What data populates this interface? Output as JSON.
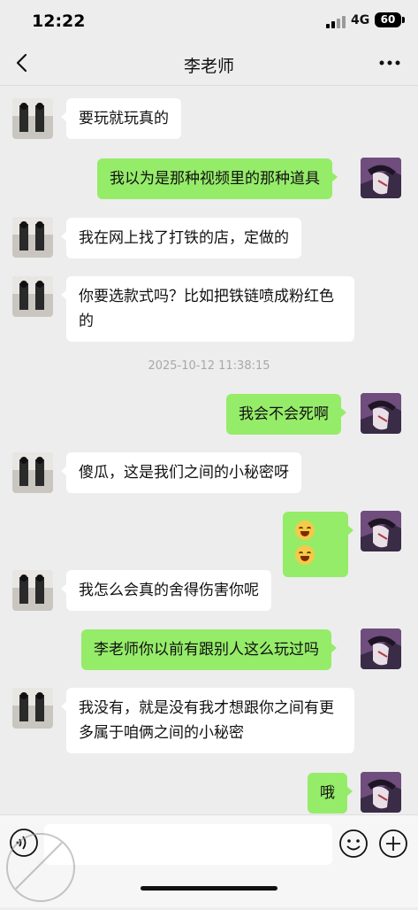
{
  "status_bar": {
    "time": "12:22",
    "network": "4G",
    "battery": "60"
  },
  "header": {
    "title": "李老师"
  },
  "timestamp": "2025-10-12 11:38:15",
  "messages": [
    {
      "side": "left",
      "text": "要玩就玩真的"
    },
    {
      "side": "right",
      "text": "我以为是那种视频里的那种道具"
    },
    {
      "side": "left",
      "text": "我在网上找了打铁的店，定做的"
    },
    {
      "side": "left",
      "text": "你要选款式吗？比如把铁链喷成粉红色的"
    },
    {
      "side": "right",
      "text": "我会不会死啊"
    },
    {
      "side": "left",
      "text": "傻瓜，这是我们之间的小秘密呀"
    },
    {
      "side": "right",
      "emoji": "rolling-on-floor-laughing-emoji",
      "count": 2
    },
    {
      "side": "left",
      "text": "我怎么会真的舍得伤害你呢"
    },
    {
      "side": "right",
      "text": "李老师你以前有跟别人这么玩过吗"
    },
    {
      "side": "left",
      "text": "我没有，就是没有我才想跟你之间有更多属于咱俩之间的小秘密"
    },
    {
      "side": "right",
      "text": "哦"
    }
  ],
  "input_bar": {
    "placeholder": ""
  },
  "colors": {
    "background": "#ededed",
    "sent_bubble": "#95ec69",
    "received_bubble": "#ffffff"
  },
  "icons": [
    "back-icon",
    "more-icon",
    "voice-icon",
    "emoji-icon",
    "plus-icon"
  ]
}
